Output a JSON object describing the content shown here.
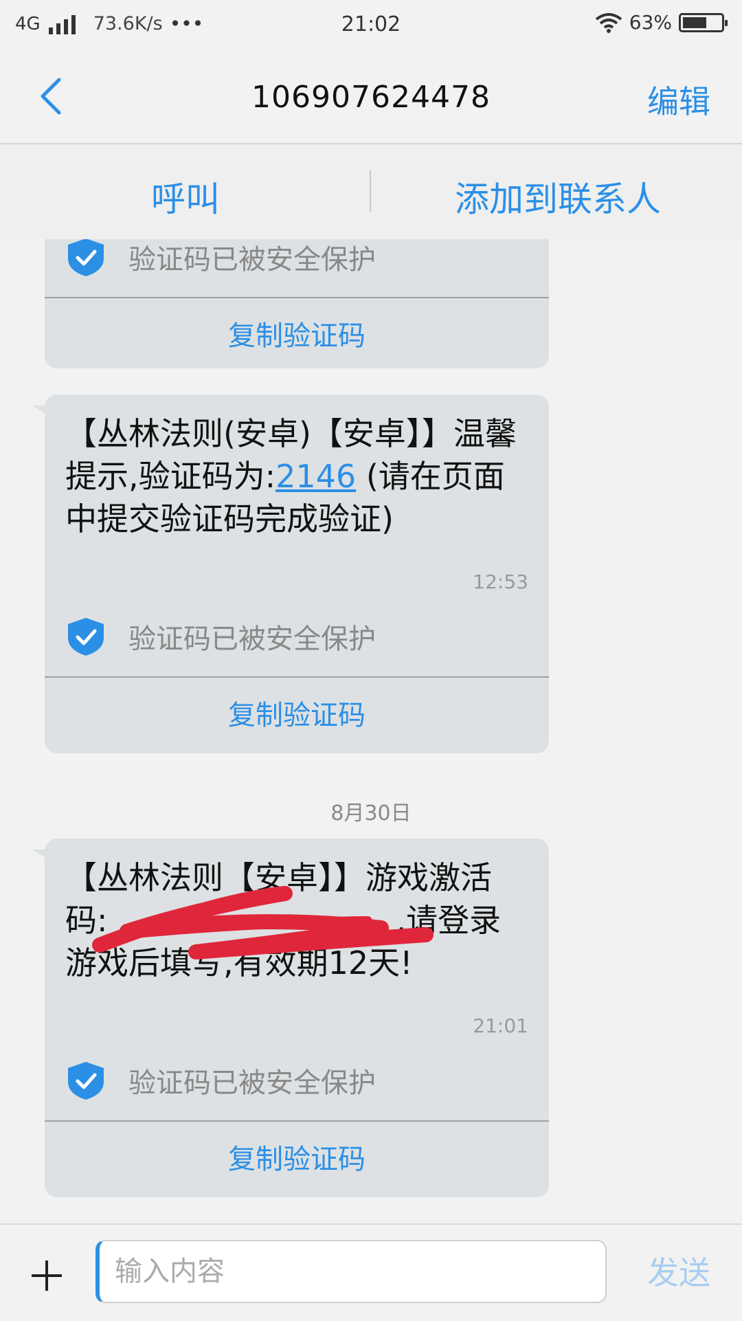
{
  "status_bar": {
    "network": "4G",
    "speed": "73.6K/s",
    "dots": "•••",
    "time": "21:02",
    "battery": "63%",
    "battery_level": 0.63
  },
  "header": {
    "title": "106907624478",
    "edit_label": "编辑"
  },
  "actions": {
    "call_label": "呼叫",
    "add_contact_label": "添加到联系人"
  },
  "messages": [
    {
      "protect_text": "验证码已被安全保护",
      "copy_label": "复制验证码"
    },
    {
      "text_before": "【丛林法则(安卓)【安卓】】温馨提示,验证码为:",
      "code": "2146",
      "text_after": " (请在页面中提交验证码完成验证)",
      "time": "12:53",
      "protect_text": "验证码已被安全保护",
      "copy_label": "复制验证码"
    },
    {
      "date": "8月30日",
      "text_before": "【丛林法则【安卓】】游戏激活码:",
      "code_redacted": true,
      "text_after": ",请登录游戏后填写,有效期12天!",
      "time": "21:01",
      "protect_text": "验证码已被安全保护",
      "copy_label": "复制验证码"
    }
  ],
  "input": {
    "placeholder": "输入内容",
    "send_label": "发送"
  },
  "colors": {
    "accent": "#2b8fe6",
    "bubble": "#dde1e3",
    "redaction": "#e0263a"
  }
}
